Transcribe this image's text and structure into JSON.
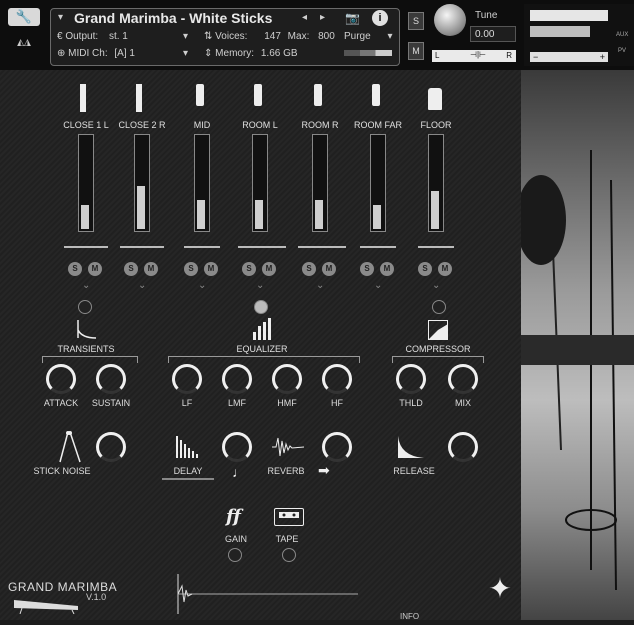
{
  "header": {
    "instrument_title": "Grand Marimba - White Sticks",
    "output_label": "Output:",
    "output_value": "st. 1",
    "voices_label": "Voices:",
    "voices_value": "147",
    "max_label": "Max:",
    "max_value": "800",
    "purge_label": "Purge",
    "midi_label": "MIDI Ch:",
    "midi_value": "[A] 1",
    "memory_label": "Memory:",
    "memory_value": "1.66 GB",
    "s_label": "S",
    "m_label": "M",
    "tune_label": "Tune",
    "tune_value": "0.00",
    "l_label": "L",
    "r_label": "R",
    "aux_label": "AUX",
    "pv_label": "PV"
  },
  "mixer": {
    "channels": [
      {
        "label": "CLOSE 1 L",
        "level": 0.25
      },
      {
        "label": "CLOSE 2 R",
        "level": 0.45
      },
      {
        "label": "MID",
        "level": 0.3
      },
      {
        "label": "ROOM L",
        "level": 0.3
      },
      {
        "label": "ROOM R",
        "level": 0.3
      },
      {
        "label": "ROOM FAR",
        "level": 0.25
      },
      {
        "label": "FLOOR",
        "level": 0.4
      }
    ],
    "solo_label": "S",
    "mute_label": "M"
  },
  "sections": {
    "transients": "TRANSIENTS",
    "equalizer": "EQUALIZER",
    "compressor": "COMPRESSOR"
  },
  "knobs": {
    "attack": "ATTACK",
    "sustain": "SUSTAIN",
    "lf": "LF",
    "lmf": "LMF",
    "hmf": "HMF",
    "hf": "HF",
    "thld": "THLD",
    "mix": "MIX",
    "stick_noise": "STICK NOISE",
    "delay": "DELAY",
    "reverb": "REVERB",
    "release": "RELEASE",
    "gain": "GAIN",
    "tape": "TAPE"
  },
  "footer": {
    "brand": "GRAND MARIMBA",
    "version": "V.1.0",
    "info": "INFO"
  }
}
